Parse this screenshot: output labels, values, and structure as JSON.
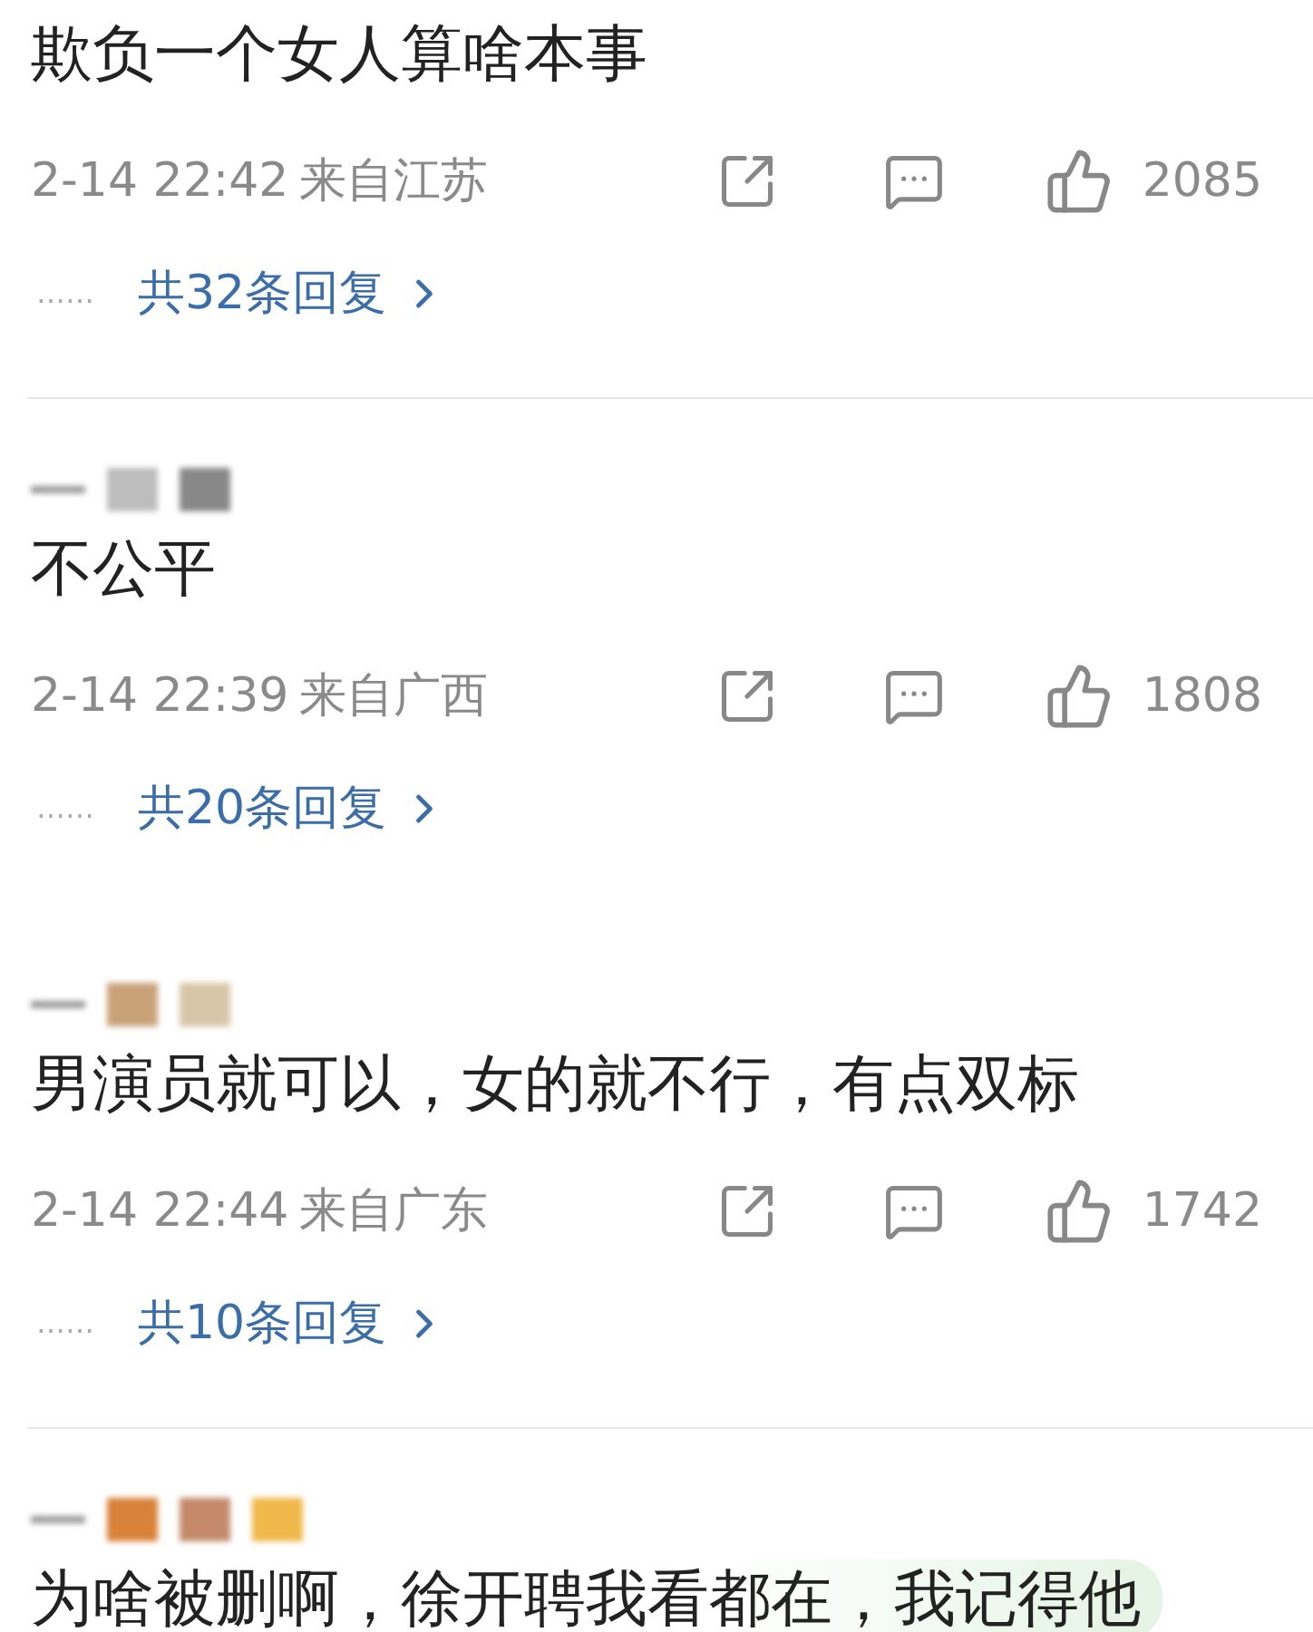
{
  "comments": [
    {
      "author_hidden": false,
      "text": "欺负一个女人算啥本事",
      "time": "2-14 22:42",
      "location": "来自江苏",
      "likes": "2085",
      "dots": "……",
      "replies": "共32条回复",
      "divider_after": true,
      "highlighted": false
    },
    {
      "author_hidden": true,
      "text": "不公平",
      "time": "2-14 22:39",
      "location": "来自广西",
      "likes": "1808",
      "dots": "……",
      "replies": "共20条回复",
      "divider_after": false,
      "highlighted": false
    },
    {
      "author_hidden": true,
      "text": "男演员就可以，女的就不行，有点双标",
      "time": "2-14 22:44",
      "location": "来自广东",
      "likes": "1742",
      "dots": "……",
      "replies": "共10条回复",
      "divider_after": true,
      "highlighted": false
    },
    {
      "author_hidden": true,
      "text": "为啥被删啊，徐开聘我看都在，我记得他",
      "highlighted": true
    }
  ]
}
